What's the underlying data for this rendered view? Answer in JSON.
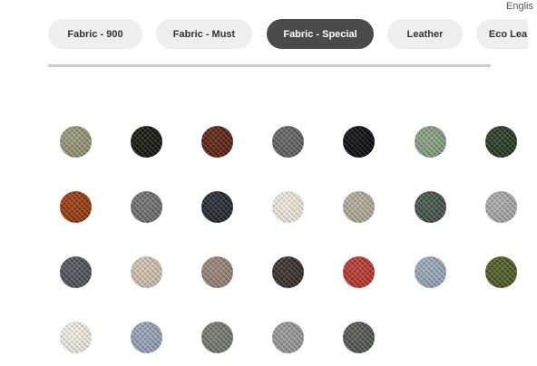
{
  "language_label": "Englis",
  "tabs": [
    {
      "label": "Fabric - 900",
      "active": false
    },
    {
      "label": "Fabric - Must",
      "active": false
    },
    {
      "label": "Fabric - Special",
      "active": true
    },
    {
      "label": "Leather",
      "active": false
    },
    {
      "label": "Eco Lea",
      "active": false
    }
  ],
  "swatches": [
    {
      "color": "#8a8a70"
    },
    {
      "color": "#1e2018"
    },
    {
      "color": "#5a2a1c"
    },
    {
      "color": "#5f5f5f"
    },
    {
      "color": "#141418"
    },
    {
      "color": "#7e927a"
    },
    {
      "color": "#2e3e2a"
    },
    {
      "color": "#8c3e18"
    },
    {
      "color": "#6a6a6a"
    },
    {
      "color": "#2c3036"
    },
    {
      "color": "#d6d0c6"
    },
    {
      "color": "#a29c8c"
    },
    {
      "color": "#44544a"
    },
    {
      "color": "#9a9a9a"
    },
    {
      "color": "#50545a"
    },
    {
      "color": "#bcaea0"
    },
    {
      "color": "#8a7a72"
    },
    {
      "color": "#3c3432"
    },
    {
      "color": "#a63c36"
    },
    {
      "color": "#8c9aa8"
    },
    {
      "color": "#4e5a2c"
    },
    {
      "color": "#d6d4ca"
    },
    {
      "color": "#8a96a6"
    },
    {
      "color": "#6e726a"
    },
    {
      "color": "#8c8c8c"
    },
    {
      "color": "#545652"
    }
  ]
}
